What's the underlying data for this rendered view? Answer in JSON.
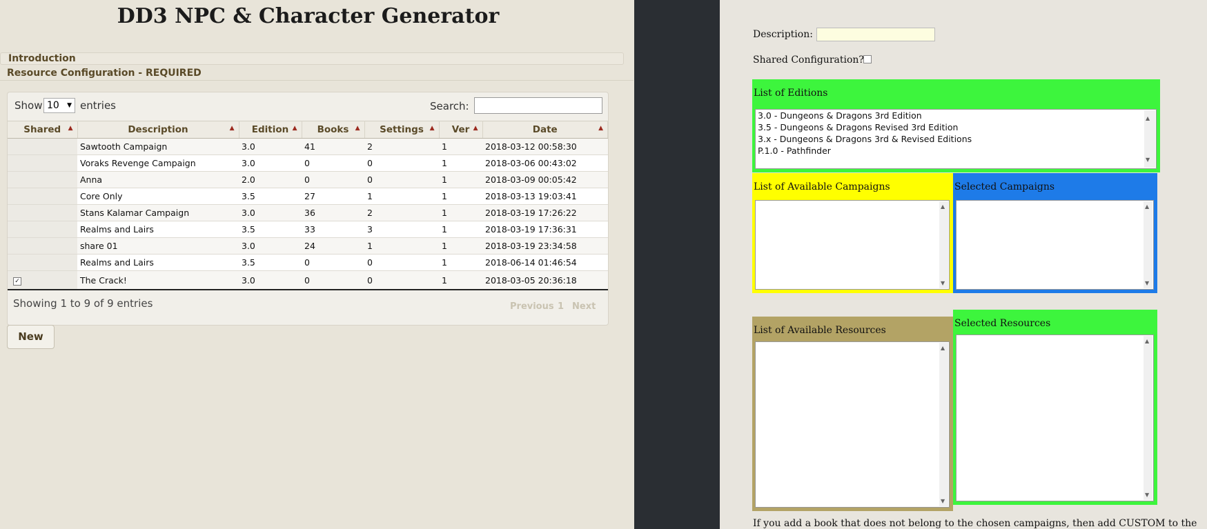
{
  "app": {
    "title": "DD3 NPC & Character Generator"
  },
  "accordion": {
    "introduction": "Introduction",
    "resource_config": "Resource Configuration - REQUIRED"
  },
  "table_controls": {
    "show_label": "Show",
    "entries_value": "10",
    "entries_label": "entries",
    "search_label": "Search:",
    "search_value": ""
  },
  "table": {
    "columns": [
      "Shared",
      "Description",
      "Edition",
      "Books",
      "Settings",
      "Ver",
      "Date"
    ],
    "rows": [
      {
        "shared": false,
        "description": "Sawtooth Campaign",
        "edition": "3.0",
        "books": "41",
        "settings": "2",
        "ver": "1",
        "date": "2018-03-12 00:58:30"
      },
      {
        "shared": false,
        "description": "Voraks Revenge Campaign",
        "edition": "3.0",
        "books": "0",
        "settings": "0",
        "ver": "1",
        "date": "2018-03-06 00:43:02"
      },
      {
        "shared": false,
        "description": "Anna",
        "edition": "2.0",
        "books": "0",
        "settings": "0",
        "ver": "1",
        "date": "2018-03-09 00:05:42"
      },
      {
        "shared": false,
        "description": "Core Only",
        "edition": "3.5",
        "books": "27",
        "settings": "1",
        "ver": "1",
        "date": "2018-03-13 19:03:41"
      },
      {
        "shared": false,
        "description": "Stans Kalamar Campaign",
        "edition": "3.0",
        "books": "36",
        "settings": "2",
        "ver": "1",
        "date": "2018-03-19 17:26:22"
      },
      {
        "shared": false,
        "description": "Realms and Lairs",
        "edition": "3.5",
        "books": "33",
        "settings": "3",
        "ver": "1",
        "date": "2018-03-19 17:36:31"
      },
      {
        "shared": false,
        "description": "share 01",
        "edition": "3.0",
        "books": "24",
        "settings": "1",
        "ver": "1",
        "date": "2018-03-19 23:34:58"
      },
      {
        "shared": false,
        "description": "Realms and Lairs",
        "edition": "3.5",
        "books": "0",
        "settings": "0",
        "ver": "1",
        "date": "2018-06-14 01:46:54"
      },
      {
        "shared": true,
        "description": "The Crack!",
        "edition": "3.0",
        "books": "0",
        "settings": "0",
        "ver": "1",
        "date": "2018-03-05 20:36:18"
      }
    ],
    "info": "Showing 1 to 9 of 9 entries",
    "pagination": {
      "previous": "Previous",
      "page": "1",
      "next": "Next"
    }
  },
  "new_button": "New",
  "form": {
    "description_label": "Description:",
    "description_value": "",
    "shared_label": "Shared Configuration?",
    "editions_title": "List of Editions",
    "editions": [
      "3.0 - Dungeons & Dragons 3rd Edition",
      "3.5 - Dungeons & Dragons Revised 3rd Edition",
      "3.x - Dungeons & Dragons 3rd & Revised Editions",
      "P.1.0 - Pathfinder"
    ],
    "available_campaigns_title": "List of Available Campaigns",
    "selected_campaigns_title": "Selected Campaigns",
    "available_resources_title": "List of Available Resources",
    "selected_resources_title": "Selected Resources",
    "footer_note": "If you add a book that does not belong to the chosen campaigns, then add CUSTOM to the"
  },
  "colors": {
    "editions_box": "#3df53d",
    "campaigns_box": "#ffff00",
    "selected_campaigns_box": "#1e7be8",
    "resources_box": "#b3a365",
    "selected_resources_box": "#3df53d"
  }
}
